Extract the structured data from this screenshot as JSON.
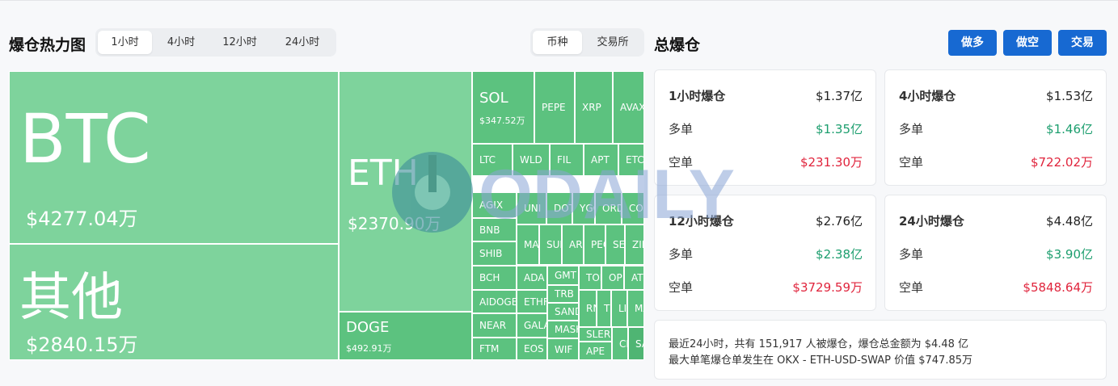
{
  "header": {
    "heatmap_title": "爆仓热力图",
    "time_tabs": [
      "1小时",
      "4小时",
      "12小时",
      "24小时"
    ],
    "active_time_tab": "1小时",
    "group_tabs": [
      "币种",
      "交易所"
    ],
    "active_group_tab": "币种",
    "total_title": "总爆仓",
    "buttons": {
      "long": "做多",
      "short": "做空",
      "trade": "交易"
    }
  },
  "treemap": {
    "cells": {
      "btc": {
        "label": "BTC",
        "value": "$4277.04万"
      },
      "other": {
        "label": "其他",
        "value": "$2840.15万"
      },
      "eth": {
        "label": "ETH",
        "value": "$2370.90万"
      },
      "doge": {
        "label": "DOGE",
        "value": "$492.91万"
      },
      "sol": {
        "label": "SOL",
        "value": "$347.52万"
      },
      "pepe": {
        "label": "PEPE"
      },
      "xrp": {
        "label": "XRP"
      },
      "avax": {
        "label": "AVAX"
      },
      "ltc": {
        "label": "LTC"
      },
      "wld": {
        "label": "WLD"
      },
      "fil": {
        "label": "FIL"
      },
      "apt": {
        "label": "APT"
      },
      "etc": {
        "label": "ETC"
      },
      "agix": {
        "label": "AGIX"
      },
      "uni": {
        "label": "UNI"
      },
      "dot": {
        "label": "DOT"
      },
      "ygg": {
        "label": "YGG"
      },
      "ordi": {
        "label": "ORDI"
      },
      "core": {
        "label": "CORE"
      },
      "bnb": {
        "label": "BNB"
      },
      "shib": {
        "label": "SHIB"
      },
      "matic": {
        "label": "MATIC"
      },
      "sui": {
        "label": "SUI"
      },
      "arb": {
        "label": "ARB"
      },
      "people": {
        "label": "PEOPLE"
      },
      "sei": {
        "label": "SEI"
      },
      "zil": {
        "label": "ZIL"
      },
      "bch": {
        "label": "BCH"
      },
      "ada": {
        "label": "ADA"
      },
      "gmt": {
        "label": "GMT"
      },
      "ton": {
        "label": "TON"
      },
      "op": {
        "label": "OP"
      },
      "atom": {
        "label": "ATOM"
      },
      "aidoge": {
        "label": "AIDOGE"
      },
      "ethfi": {
        "label": "ETHFI"
      },
      "trb": {
        "label": "TRB"
      },
      "sand": {
        "label": "SAND"
      },
      "rndr": {
        "label": "RNDR"
      },
      "tia": {
        "label": "TIA"
      },
      "link": {
        "label": "LINK"
      },
      "manta": {
        "label": "MANTA"
      },
      "near": {
        "label": "NEAR"
      },
      "gala": {
        "label": "GALA"
      },
      "mask": {
        "label": "MASK"
      },
      "slerf": {
        "label": "SLERF"
      },
      "ftm": {
        "label": "FTM"
      },
      "eos": {
        "label": "EOS"
      },
      "wif": {
        "label": "WIF"
      },
      "ape": {
        "label": "APE"
      },
      "crv": {
        "label": "CRV"
      },
      "sats": {
        "label": "SATS"
      }
    }
  },
  "stats": [
    {
      "title": "1小时爆仓",
      "total": "$1.37亿",
      "long_label": "多单",
      "long": "$1.35亿",
      "short_label": "空单",
      "short": "$231.30万"
    },
    {
      "title": "4小时爆仓",
      "total": "$1.53亿",
      "long_label": "多单",
      "long": "$1.46亿",
      "short_label": "空单",
      "short": "$722.02万"
    },
    {
      "title": "12小时爆仓",
      "total": "$2.76亿",
      "long_label": "多单",
      "long": "$2.38亿",
      "short_label": "空单",
      "short": "$3729.59万"
    },
    {
      "title": "24小时爆仓",
      "total": "$4.48亿",
      "long_label": "多单",
      "long": "$3.90亿",
      "short_label": "空单",
      "short": "$5848.64万"
    }
  ],
  "summary": {
    "line1": "最近24小时，共有 151,917 人被爆仓，爆仓总金额为 $4.48 亿",
    "line2": "最大单笔爆仓单发生在 OKX - ETH-USD-SWAP 价值 $747.85万"
  },
  "watermark": {
    "text": "ODAILY",
    "icon": "odaily-logo-icon"
  },
  "colors": {
    "long": "#1c9e6e",
    "short": "#e0243c",
    "button": "#1769d2",
    "treemap_light": "#7ed39c",
    "treemap_mid": "#5cc27f"
  }
}
